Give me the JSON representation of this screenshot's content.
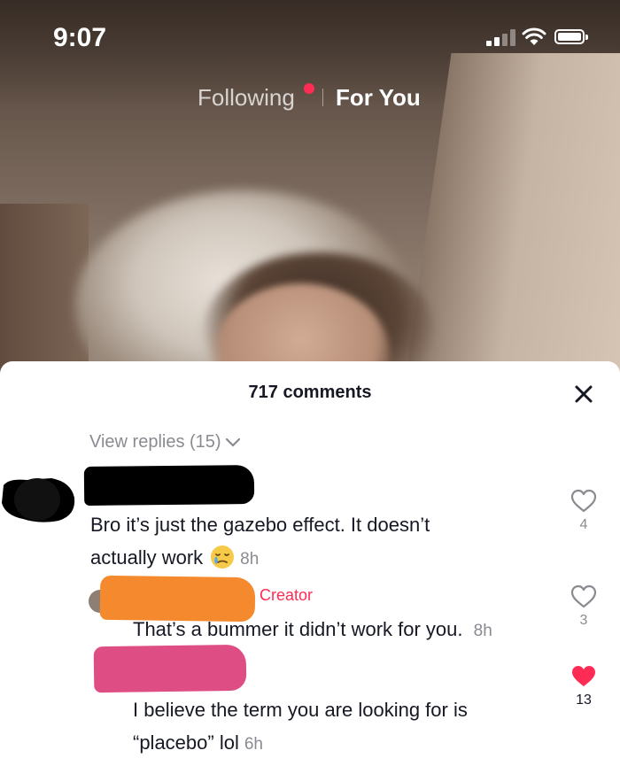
{
  "status_bar": {
    "time": "9:07",
    "icons": [
      "cellular-signal-icon",
      "wifi-icon",
      "battery-icon"
    ]
  },
  "top_nav": {
    "following_label": "Following",
    "for_you_label": "For You",
    "live_indicator_color": "#fe2c55"
  },
  "comments_sheet": {
    "title": "717 comments",
    "close_icon": "close-icon",
    "view_replies_label": "View replies (15)",
    "comments": [
      {
        "text_line1": "Bro it’s just the gazebo effect. It doesn’t",
        "text_line2": "actually work",
        "emoji": "sad-face-emoji",
        "time": "8h",
        "likes": "4",
        "liked": false
      }
    ],
    "replies": [
      {
        "badge": "Creator",
        "text": "That’s a bummer it didn’t work for you.",
        "time": "8h",
        "likes": "3",
        "liked": false
      },
      {
        "text_line1": "I believe the term you are looking for is",
        "text_line2": "“placebo” lol",
        "time": "6h",
        "likes": "13",
        "liked": true
      }
    ]
  },
  "colors": {
    "accent": "#fe2c55",
    "text_primary": "#161823",
    "text_secondary": "#8a8b91",
    "redaction_black": "#000000",
    "redaction_orange": "#f5892d",
    "redaction_pink": "#de4d83"
  }
}
